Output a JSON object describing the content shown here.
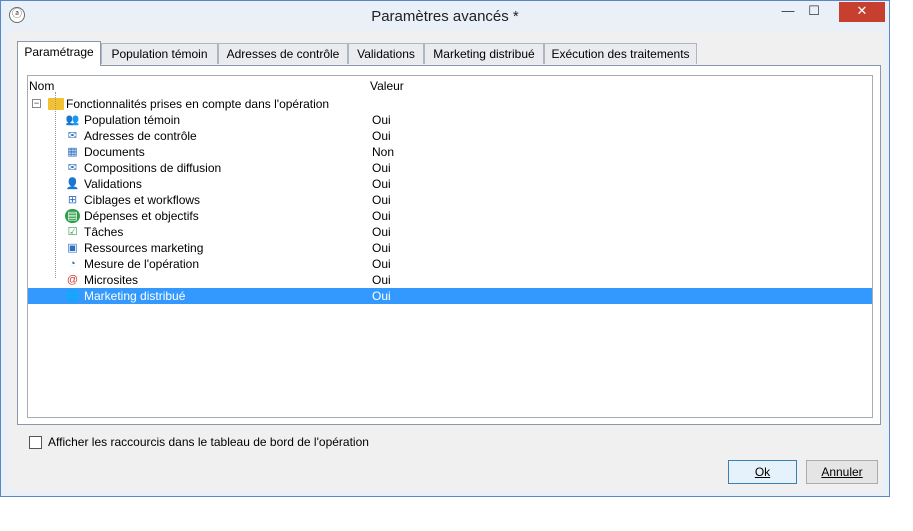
{
  "window": {
    "title": "Paramètres avancés *",
    "controls": {
      "minimize": "—",
      "maximize": "☐",
      "close": "✕"
    }
  },
  "tabs": [
    {
      "label": "Paramétrage",
      "active": true
    },
    {
      "label": "Population témoin"
    },
    {
      "label": "Adresses de contrôle"
    },
    {
      "label": "Validations"
    },
    {
      "label": "Marketing distribué"
    },
    {
      "label": "Exécution des traitements"
    }
  ],
  "tree": {
    "columns": {
      "name": "Nom",
      "value": "Valeur"
    },
    "root": {
      "label": "Fonctionnalités prises en compte dans l'opération",
      "expander": "−"
    },
    "items": [
      {
        "label": "Population témoin",
        "value": "Oui",
        "icon": "people-icon"
      },
      {
        "label": "Adresses de contrôle",
        "value": "Oui",
        "icon": "mail-question-icon"
      },
      {
        "label": "Documents",
        "value": "Non",
        "icon": "documents-icon"
      },
      {
        "label": "Compositions de diffusion",
        "value": "Oui",
        "icon": "mail-list-icon"
      },
      {
        "label": "Validations",
        "value": "Oui",
        "icon": "user-check-icon"
      },
      {
        "label": "Ciblages et workflows",
        "value": "Oui",
        "icon": "workflow-icon"
      },
      {
        "label": "Dépenses et objectifs",
        "value": "Oui",
        "icon": "calculator-icon"
      },
      {
        "label": "Tâches",
        "value": "Oui",
        "icon": "task-check-icon"
      },
      {
        "label": "Ressources marketing",
        "value": "Oui",
        "icon": "resources-icon"
      },
      {
        "label": "Mesure de l'opération",
        "value": "Oui",
        "icon": "gauge-icon"
      },
      {
        "label": "Microsites",
        "value": "Oui",
        "icon": "microsite-icon"
      },
      {
        "label": "Marketing distribué",
        "value": "Oui",
        "icon": "globe-lock-icon",
        "selected": true
      }
    ]
  },
  "options": {
    "shortcut_checkbox_label": "Afficher les raccourcis dans le tableau de bord de l'opération",
    "shortcut_checked": false
  },
  "buttons": {
    "ok": "Ok",
    "cancel": "Annuler"
  },
  "colors": {
    "selection": "#3399ff",
    "close_button": "#c7402f",
    "window_border": "#5b86c7"
  }
}
